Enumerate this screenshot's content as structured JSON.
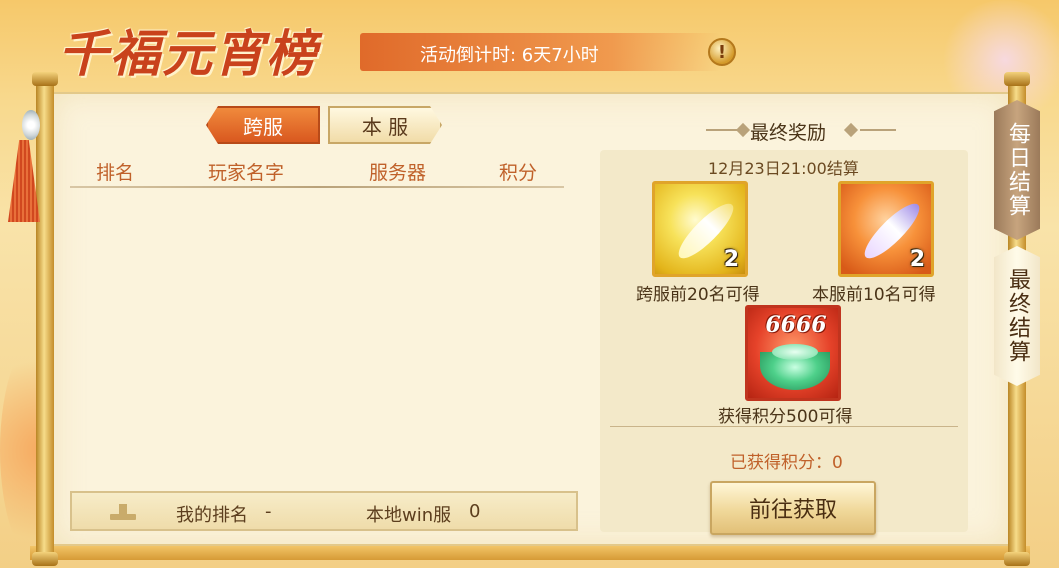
{
  "header": {
    "title": "千福元宵榜",
    "countdown": "活动倒计时: 6天7小时",
    "info_icon": "info-icon"
  },
  "tabs": [
    {
      "label": "跨服",
      "active": true
    },
    {
      "label": "本 服",
      "active": false
    }
  ],
  "table": {
    "columns": [
      "排名",
      "玩家名字",
      "服务器",
      "积分"
    ],
    "rows": []
  },
  "my_rank": {
    "label": "我的排名",
    "value": "-",
    "server": "本地win服",
    "score": "0"
  },
  "reward": {
    "title": "最终奖励",
    "settle_time": "12月23日21:00结算",
    "items": [
      {
        "count": "2",
        "caption": "跨服前20名可得",
        "icon": "gold-feather-icon"
      },
      {
        "count": "2",
        "caption": "本服前10名可得",
        "icon": "purple-feather-icon"
      },
      {
        "points": "6666",
        "caption": "获得积分500可得",
        "icon": "jade-ingot-icon"
      }
    ],
    "earned": "已获得积分：0",
    "button": "前往获取"
  },
  "side_tabs": [
    {
      "label": "每日结算",
      "active": false
    },
    {
      "label": "最终结算",
      "active": true
    }
  ],
  "colors": {
    "accent": "#d9581f",
    "header_text": "#c0612a",
    "panel_bg": "#fbf3dc"
  }
}
